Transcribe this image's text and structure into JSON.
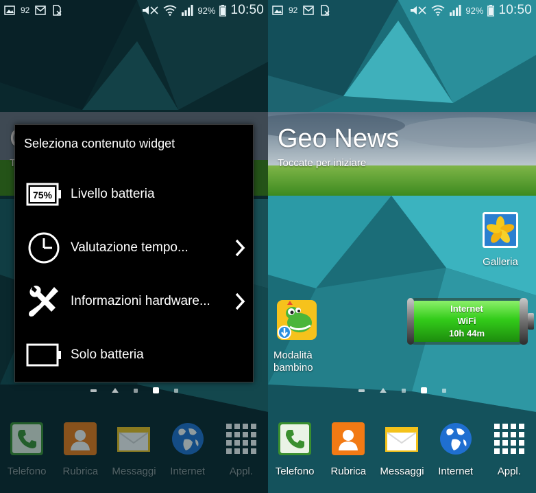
{
  "status_bar": {
    "battery_percent_small": "92",
    "battery_percent": "92%",
    "time": "10:50"
  },
  "geo_news": {
    "title": "Geo News",
    "subtitle": "Toccate per iniziare"
  },
  "dialog": {
    "title": "Seleziona contenuto widget",
    "items": [
      {
        "label": "Livello batteria",
        "icon": "battery-75-icon",
        "icon_text": "75%",
        "has_submenu": false
      },
      {
        "label": "Valutazione tempo...",
        "icon": "clock-icon",
        "has_submenu": true
      },
      {
        "label": "Informazioni hardware...",
        "icon": "tools-icon",
        "has_submenu": true
      },
      {
        "label": "Solo batteria",
        "icon": "battery-empty-icon",
        "has_submenu": false
      }
    ]
  },
  "home_icons": {
    "galleria": "Galleria",
    "kids_mode": [
      "Modalità",
      "bambino"
    ]
  },
  "battery_widget": {
    "line1": "Internet",
    "line2": "WiFi",
    "line3": "10h 44m",
    "level": 1.0
  },
  "dock": {
    "items": [
      {
        "label": "Telefono",
        "icon": "phone-icon"
      },
      {
        "label": "Rubrica",
        "icon": "contacts-icon"
      },
      {
        "label": "Messaggi",
        "icon": "messages-icon"
      },
      {
        "label": "Internet",
        "icon": "globe-icon"
      },
      {
        "label": "Appl.",
        "icon": "apps-grid-icon"
      }
    ]
  },
  "colors": {
    "wallpaper_dark": "#0d3a45",
    "wallpaper_light": "#2fa6b3",
    "battery_green": "#33cc1a"
  }
}
